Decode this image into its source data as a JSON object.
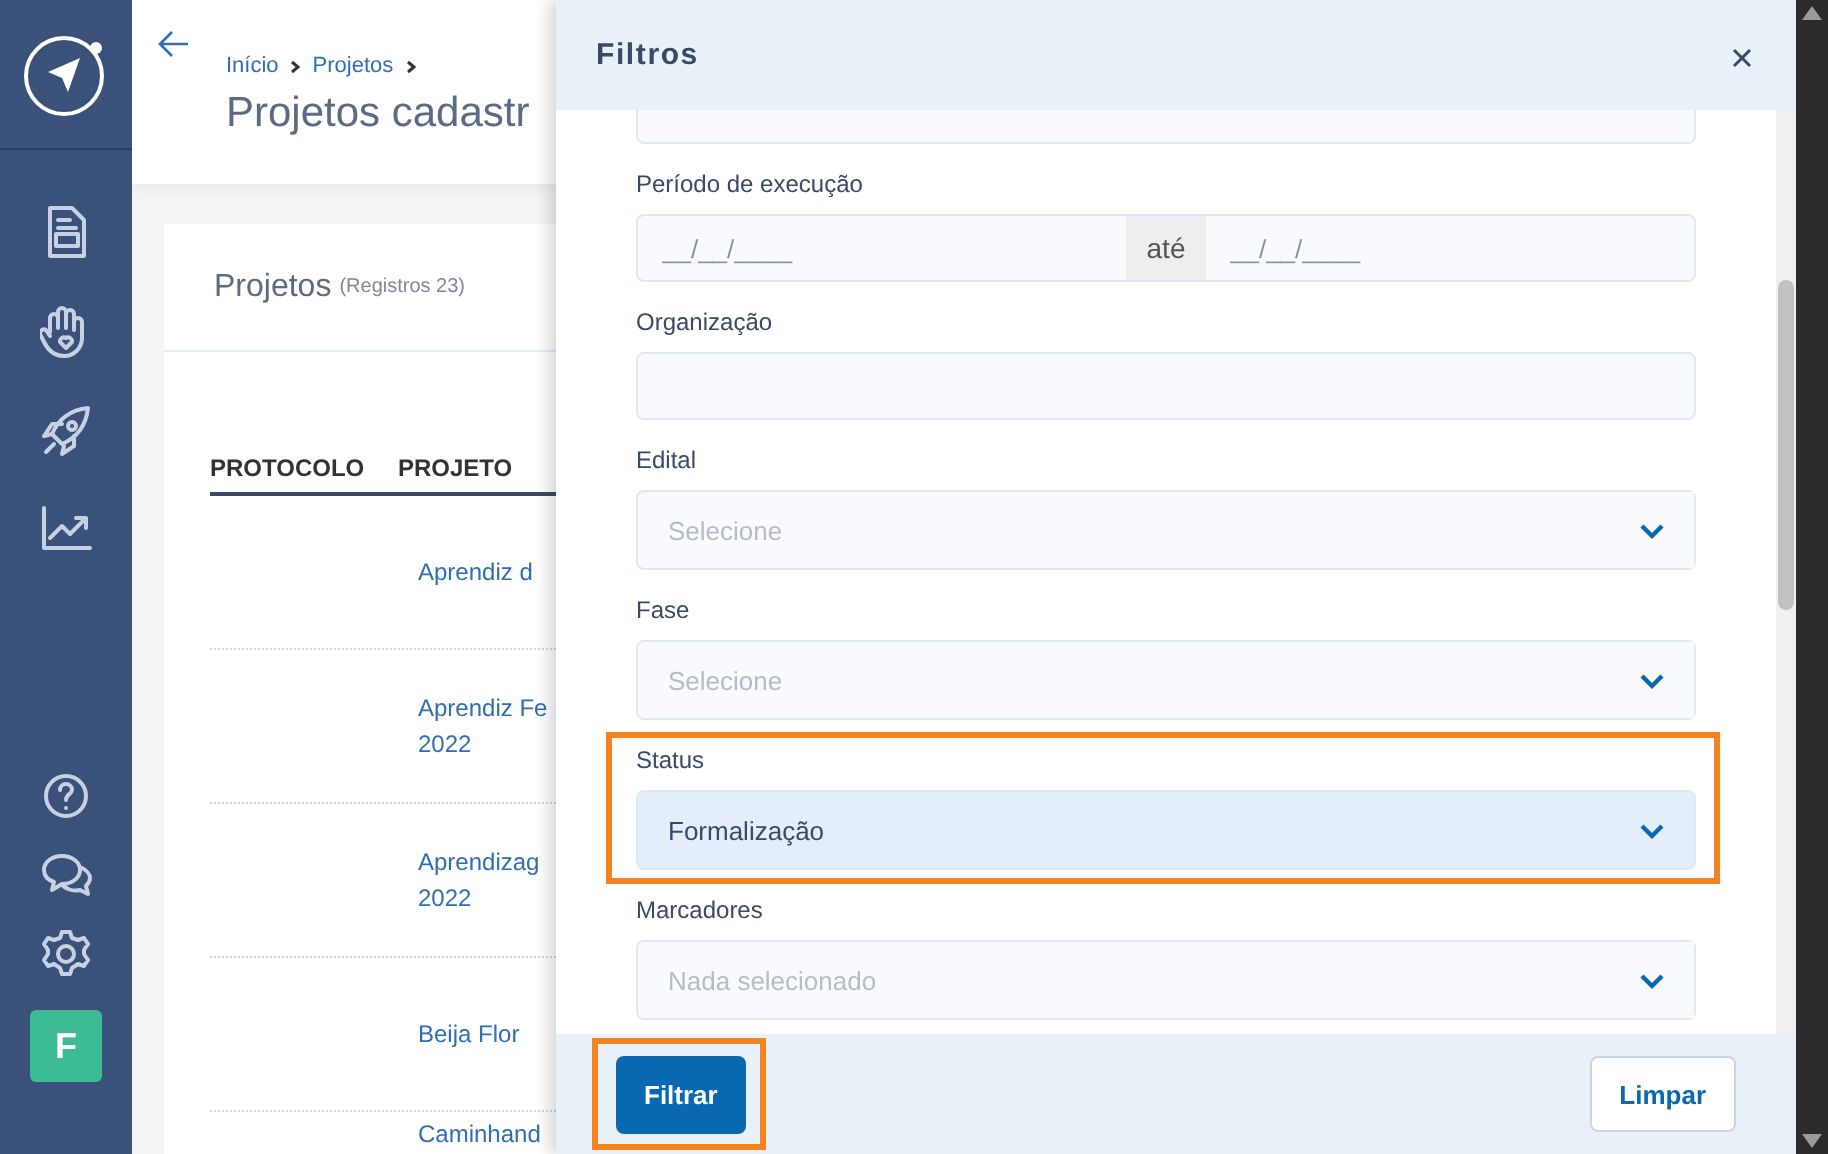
{
  "sidebar": {
    "avatar_initial": "F"
  },
  "header": {
    "breadcrumbs": [
      "Início",
      "Projetos"
    ],
    "title": "Projetos cadastr"
  },
  "card": {
    "title": "Projetos",
    "count": "(Registros 23)",
    "table": {
      "columns": [
        "PROTOCOLO",
        "PROJETO"
      ],
      "rows": [
        {
          "projeto": [
            "Aprendiz d"
          ]
        },
        {
          "projeto": [
            "Aprendiz Fe",
            "2022"
          ]
        },
        {
          "projeto": [
            "Aprendizag",
            "2022"
          ]
        },
        {
          "projeto": [
            "Beija Flor"
          ]
        },
        {
          "projeto": [
            "Caminhand"
          ]
        }
      ]
    }
  },
  "filters": {
    "title": "Filtros",
    "fields": [
      {
        "kind": "partial"
      },
      {
        "kind": "date_range",
        "label": "Período de execução",
        "from_placeholder": "__/__/____",
        "separator": "até",
        "to_placeholder": "__/__/____"
      },
      {
        "kind": "text",
        "label": "Organização"
      },
      {
        "kind": "select",
        "label": "Edital",
        "placeholder": "Selecione",
        "highlighted": false
      },
      {
        "kind": "select",
        "label": "Fase",
        "placeholder": "Selecione",
        "highlighted": false
      },
      {
        "kind": "select",
        "label": "Status",
        "value": "Formalização",
        "highlighted": true
      },
      {
        "kind": "select",
        "label": "Marcadores",
        "placeholder": "Nada selecionado",
        "highlighted": false
      }
    ],
    "buttons": [
      {
        "kind": "primary",
        "label": "Filtrar",
        "highlighted": true
      },
      {
        "kind": "secondary",
        "label": "Limpar",
        "highlighted": false
      }
    ]
  }
}
